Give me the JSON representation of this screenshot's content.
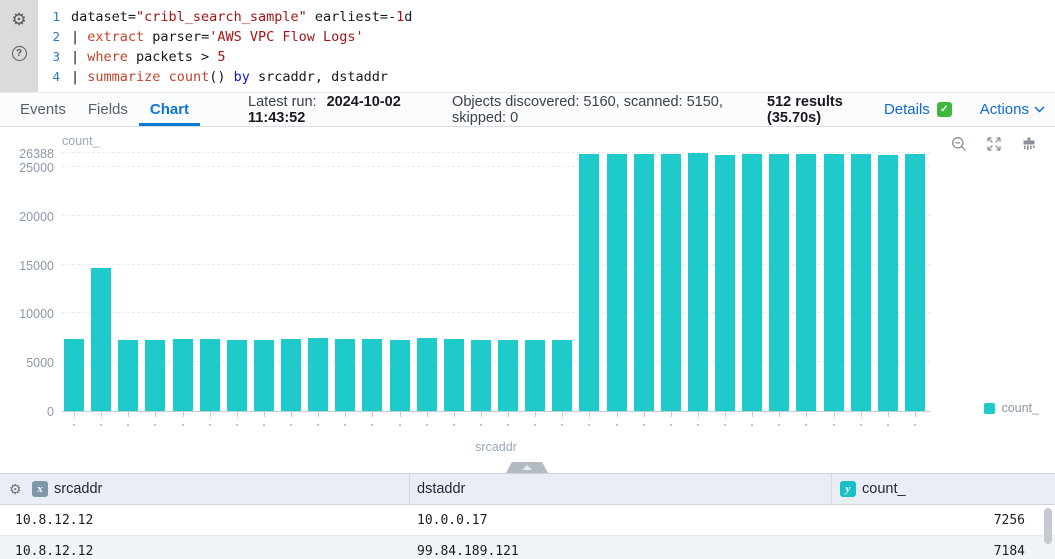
{
  "editor": {
    "lines": [
      {
        "num": "1",
        "tokens": [
          [
            "dataset=",
            "plain"
          ],
          [
            "\"cribl_search_sample\"",
            "string"
          ],
          [
            " earliest=-",
            "plain"
          ],
          [
            "1",
            "number"
          ],
          [
            "d",
            "plain"
          ]
        ]
      },
      {
        "num": "2",
        "tokens": [
          [
            "| ",
            "plain"
          ],
          [
            "extract",
            "keyword"
          ],
          [
            " parser=",
            "plain"
          ],
          [
            "'AWS VPC Flow Logs'",
            "string"
          ]
        ]
      },
      {
        "num": "3",
        "tokens": [
          [
            "| ",
            "plain"
          ],
          [
            "where",
            "keyword"
          ],
          [
            " packets > ",
            "plain"
          ],
          [
            "5",
            "number"
          ]
        ]
      },
      {
        "num": "4",
        "tokens": [
          [
            "| ",
            "plain"
          ],
          [
            "summarize",
            "keyword"
          ],
          [
            " ",
            "plain"
          ],
          [
            "count",
            "keyword"
          ],
          [
            "()",
            "plain"
          ],
          [
            " ",
            "plain"
          ],
          [
            "by",
            "op"
          ],
          [
            " srcaddr, dstaddr",
            "plain"
          ]
        ]
      }
    ]
  },
  "tabbar": {
    "tabs": [
      {
        "label": "Events"
      },
      {
        "label": "Fields"
      },
      {
        "label": "Chart"
      }
    ],
    "latest_run_label": "Latest run:",
    "latest_run_value": "2024-10-02 11:43:52",
    "objects_stats": "Objects discovered: 5160, scanned: 5150, skipped: 0",
    "results_summary": "512 results (35.70s)",
    "details_label": "Details",
    "actions_label": "Actions"
  },
  "chart_data": {
    "type": "bar",
    "title": "count_",
    "xlabel": "srcaddr",
    "ylabel": "count_",
    "legend": [
      "count_"
    ],
    "legend_position": "bottom-right",
    "ylim": [
      0,
      26388
    ],
    "yticks": [
      0,
      5000,
      10000,
      15000,
      20000,
      25000,
      26388
    ],
    "grid": "horizontal-dashed",
    "series_color": "#1ecaca",
    "x_tick_labels_truncated": true,
    "values": [
      7350,
      14700,
      7300,
      7310,
      7420,
      7400,
      7320,
      7230,
      7330,
      7430,
      7400,
      7330,
      7300,
      7440,
      7370,
      7310,
      7280,
      7320,
      7300,
      26350,
      26300,
      26330,
      26320,
      26388,
      26200,
      26310,
      26300,
      26320,
      26310,
      26360,
      26280,
      26320
    ]
  },
  "table": {
    "columns": [
      {
        "badge": "x",
        "label": "srcaddr"
      },
      {
        "badge": "",
        "label": "dstaddr"
      },
      {
        "badge": "y",
        "label": "count_"
      }
    ],
    "rows": [
      [
        "10.8.12.12",
        "10.0.0.17",
        "7256"
      ],
      [
        "10.8.12.12",
        "99.84.189.121",
        "7184"
      ]
    ]
  },
  "colors": {
    "accent_blue": "#1269d3",
    "series_teal": "#1ecaca",
    "check_green": "#3db83d",
    "keyword": "#c0452a",
    "string": "#a31515",
    "operator_blue": "#1414d2"
  }
}
